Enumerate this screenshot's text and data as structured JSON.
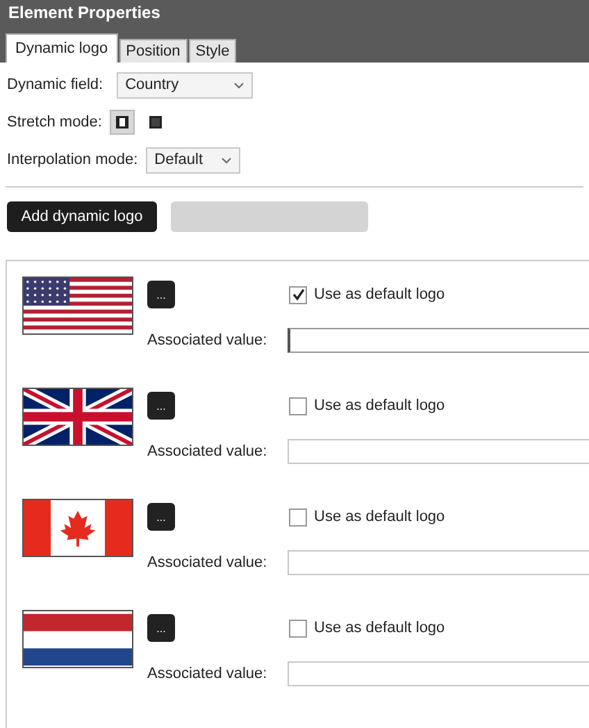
{
  "window": {
    "title": "Element Properties"
  },
  "tabs": [
    {
      "label": "Dynamic logo",
      "selected": true
    },
    {
      "label": "Position",
      "selected": false
    },
    {
      "label": "Style",
      "selected": false
    }
  ],
  "dynamic_field": {
    "label": "Dynamic field:",
    "value": "Country"
  },
  "stretch_mode": {
    "label": "Stretch mode:",
    "options": [
      {
        "selected": true
      },
      {
        "selected": false
      }
    ]
  },
  "interpolation_mode": {
    "label": "Interpolation mode:",
    "value": "Default"
  },
  "buttons": [
    {
      "label": "Add dynamic logo",
      "disabled": false
    },
    {
      "disabled": true
    }
  ],
  "logos": [
    {
      "kind": "us",
      "browse": "...",
      "default_label": "Use as default logo",
      "checked": true,
      "value_label": "Associated value:"
    },
    {
      "kind": "uk",
      "browse": "...",
      "default_label": "Use as default logo",
      "checked": false,
      "value_label": "Associated value:"
    },
    {
      "kind": "ca",
      "browse": "...",
      "default_label": "Use as default logo",
      "checked": false,
      "value_label": "Associated value:"
    },
    {
      "kind": "nl",
      "browse": "...",
      "default_label": "Use as default logo",
      "checked": false,
      "value_label": "Associated value:"
    }
  ]
}
